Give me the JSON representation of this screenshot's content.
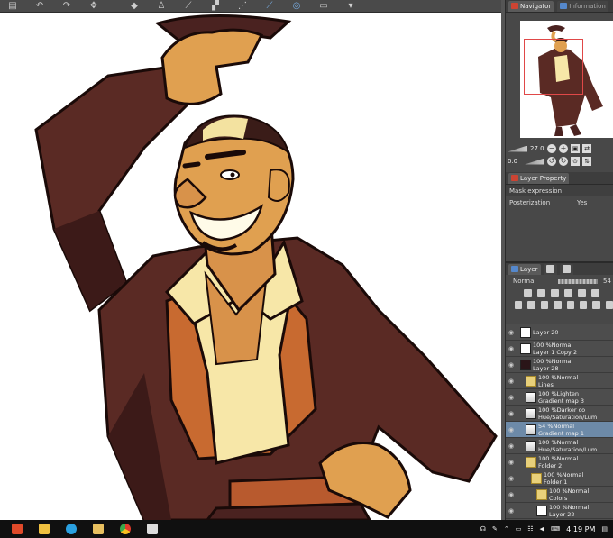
{
  "toolbar": {
    "icons": [
      "save-icon",
      "undo-icon",
      "redo-icon",
      "transform-icon",
      "fill-icon",
      "stamp-icon",
      "pen-icon",
      "ruler-icon",
      "snap-icon",
      "blue-pen-icon",
      "box-icon"
    ]
  },
  "navigator": {
    "tab_label": "Navigator",
    "tab2_label": "Information",
    "zoom_value": "27.0",
    "rotate_value": "0.0"
  },
  "layer_property": {
    "tab_label": "Layer Property",
    "mask_expression": "Mask expression",
    "posterization_label": "Posterization",
    "posterization_value": "Yes"
  },
  "layer_panel": {
    "tab_label": "Layer",
    "blend_mode": "Normal",
    "opacity_value": "54"
  },
  "layers": [
    {
      "mode": "",
      "name": "Layer 20",
      "thumb": "white",
      "indent": 0,
      "selected": false
    },
    {
      "mode": "100 %Normal",
      "name": "Layer 1 Copy 2",
      "thumb": "white",
      "indent": 0,
      "selected": false
    },
    {
      "mode": "100 %Normal",
      "name": "Layer 28",
      "thumb": "dark",
      "indent": 0,
      "selected": false
    },
    {
      "mode": "100 %Normal",
      "name": "Lines",
      "thumb": "folder",
      "indent": 1,
      "selected": false
    },
    {
      "mode": "100 %Lighten",
      "name": "Gradient map 3",
      "thumb": "grad",
      "indent": 1,
      "selected": false
    },
    {
      "mode": "100 %Darker co",
      "name": "Hue/Saturation/Lum",
      "thumb": "grad",
      "indent": 1,
      "selected": false
    },
    {
      "mode": "54 %Normal",
      "name": "Gradient map 1",
      "thumb": "grad",
      "indent": 1,
      "selected": true
    },
    {
      "mode": "100 %Normal",
      "name": "Hue/Saturation/Lum",
      "thumb": "grad",
      "indent": 1,
      "selected": false
    },
    {
      "mode": "100 %Normal",
      "name": "Folder 2",
      "thumb": "folder",
      "indent": 1,
      "selected": false
    },
    {
      "mode": "100 %Normal",
      "name": "Folder 1",
      "thumb": "folder",
      "indent": 2,
      "selected": false
    },
    {
      "mode": "100 %Normal",
      "name": "Colors",
      "thumb": "folder",
      "indent": 3,
      "selected": false
    },
    {
      "mode": "100 %Normal",
      "name": "Layer 22",
      "thumb": "white",
      "indent": 3,
      "selected": false
    },
    {
      "mode": "100 %Normal",
      "name": "",
      "thumb": "white",
      "indent": 3,
      "selected": false
    }
  ],
  "taskbar": {
    "apps": [
      "windows-store-icon",
      "file-explorer-icon",
      "telegram-icon",
      "folder-icon",
      "chrome-icon",
      "clip-studio-icon"
    ],
    "time": "4:19 PM",
    "date": ""
  },
  "colors": {
    "coat": "#5a2a24",
    "coat_shadow": "#3c1a18",
    "skin": "#e0a050",
    "shirt": "#f7e7a8",
    "vest": "#c86a30"
  }
}
